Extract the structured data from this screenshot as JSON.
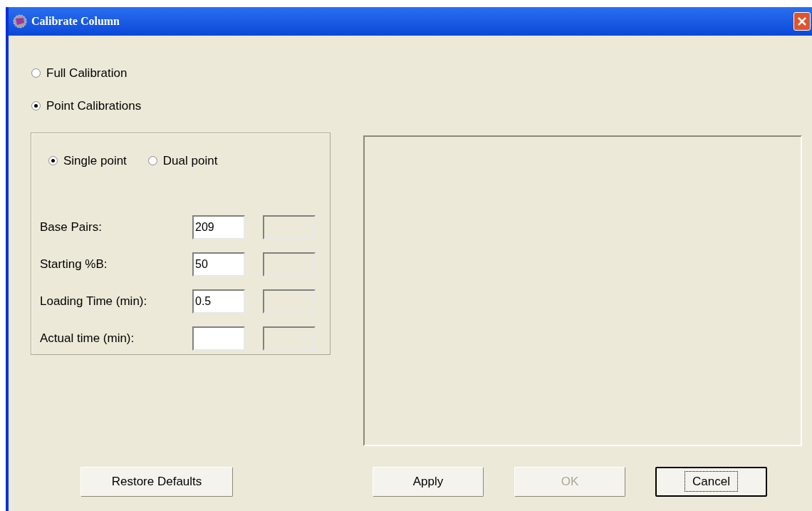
{
  "window": {
    "title": "Calibrate Column"
  },
  "mode_options": [
    {
      "label": "Full Calibration",
      "selected": false
    },
    {
      "label": "Point Calibrations",
      "selected": true
    }
  ],
  "point_options": [
    {
      "label": "Single point",
      "selected": true
    },
    {
      "label": "Dual point",
      "selected": false
    }
  ],
  "fields": [
    {
      "label": "Base Pairs:",
      "value": "209",
      "second_disabled": true
    },
    {
      "label": "Starting %B:",
      "value": "50",
      "second_disabled": true
    },
    {
      "label": "Loading Time (min):",
      "value": "0.5",
      "second_disabled": true
    },
    {
      "label": "Actual time (min):",
      "second_disabled": true
    }
  ],
  "buttons": [
    {
      "label": "Restore Defaults",
      "disabled": false,
      "default": false
    },
    {
      "label": "Apply",
      "disabled": false,
      "default": false
    },
    {
      "label": "OK",
      "disabled": true,
      "default": false
    },
    {
      "label": "Cancel",
      "disabled": false,
      "default": true
    }
  ]
}
